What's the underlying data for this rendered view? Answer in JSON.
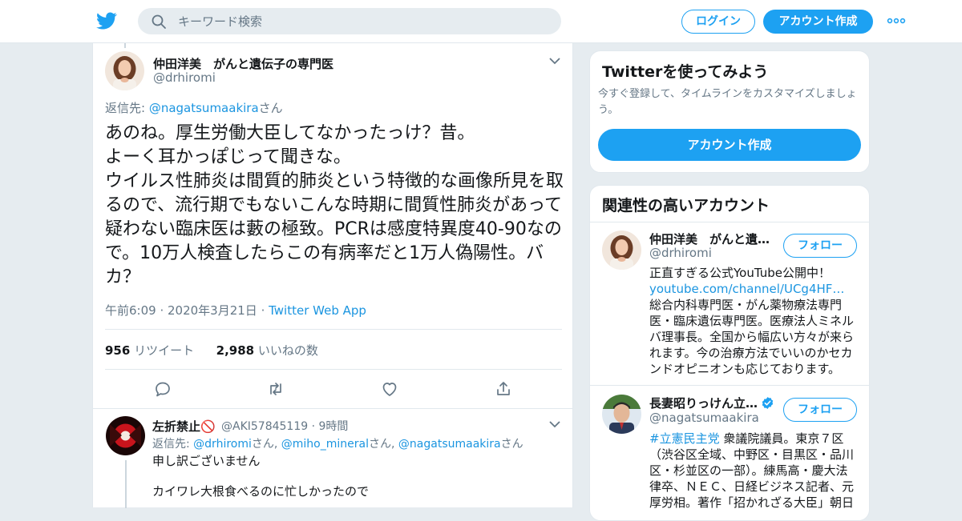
{
  "header": {
    "search_placeholder": "キーワード検索",
    "login_label": "ログイン",
    "signup_label": "アカウント作成"
  },
  "tweet": {
    "author_name": "仲田洋美　がんと遺伝子の専門医",
    "author_handle": "@drhiromi",
    "reply_prefix": "返信先: ",
    "reply_handle": "@nagatsumaakira",
    "reply_suffix": "さん",
    "text": "あのね。厚生労働大臣してなかったっけ？昔。\nよーく耳かっぽじって聞きな。\nウイルス性肺炎は間質的肺炎という特徴的な画像所見を取るので、流行期でもないこんな時期に間質性肺炎があって疑わない臨床医は藪の極致。PCRは感度特異度40-90なので。10万人検査したらこの有病率だと1万人偽陽性。バカ？",
    "timestamp": "午前6:09 · 2020年3月21日",
    "dot": " · ",
    "source": "Twitter Web App",
    "retweets_count": "956",
    "retweets_label": "リツイート",
    "likes_count": "2,988",
    "likes_label": "いいねの数"
  },
  "reply": {
    "author_name": "左折禁止🚫",
    "author_handle": "@AKI57845119",
    "time": " · 9時間",
    "reply_prefix": "返信先: ",
    "handle1": "@drhiromi",
    "san1": "さん, ",
    "handle2": "@miho_mineral",
    "san2": "さん, ",
    "handle3": "@nagatsumaakira",
    "san3": "さん",
    "line1": "申し訳ございません",
    "line2": "カイワレ大根食べるのに忙しかったので"
  },
  "sidebar": {
    "try_title": "Twitterを使ってみよう",
    "try_sub": "今すぐ登録して、タイムラインをカスタマイズしましょう。",
    "try_button": "アカウント作成",
    "related_title": "関連性の高いアカウント",
    "accounts": [
      {
        "name": "仲田洋美　がんと遺…",
        "handle": "@drhiromi",
        "follow_label": "フォロー",
        "bio_text1": "正直すぎる公式YouTube公開中！",
        "bio_link": "youtube.com/channel/UCg4HF…",
        "bio_text2": "　総合内科専門医・がん薬物療法専門医・臨床遺伝専門医。医療法人ミネルバ理事長。全国から幅広い方々が来られます。今の治療方法でいいのかセカンドオピニオンも応じております。"
      },
      {
        "name": "長妻昭りっけん立…",
        "handle": "@nagatsumaakira",
        "follow_label": "フォロー",
        "bio_link": "#立憲民主党",
        "bio_text2": " 衆議院議員。東京７区（渋谷区全域、中野区・目黒区・品川区・杉並区の一部）。練馬高・慶大法律卒、ＮＥＣ、日経ビジネス記者、元厚労相。著作「招かれざる大臣」朝日"
      }
    ]
  },
  "colors": {
    "accent": "#1da1f2",
    "link": "#1b95e0",
    "muted": "#657786",
    "background": "#e6ecf0"
  }
}
